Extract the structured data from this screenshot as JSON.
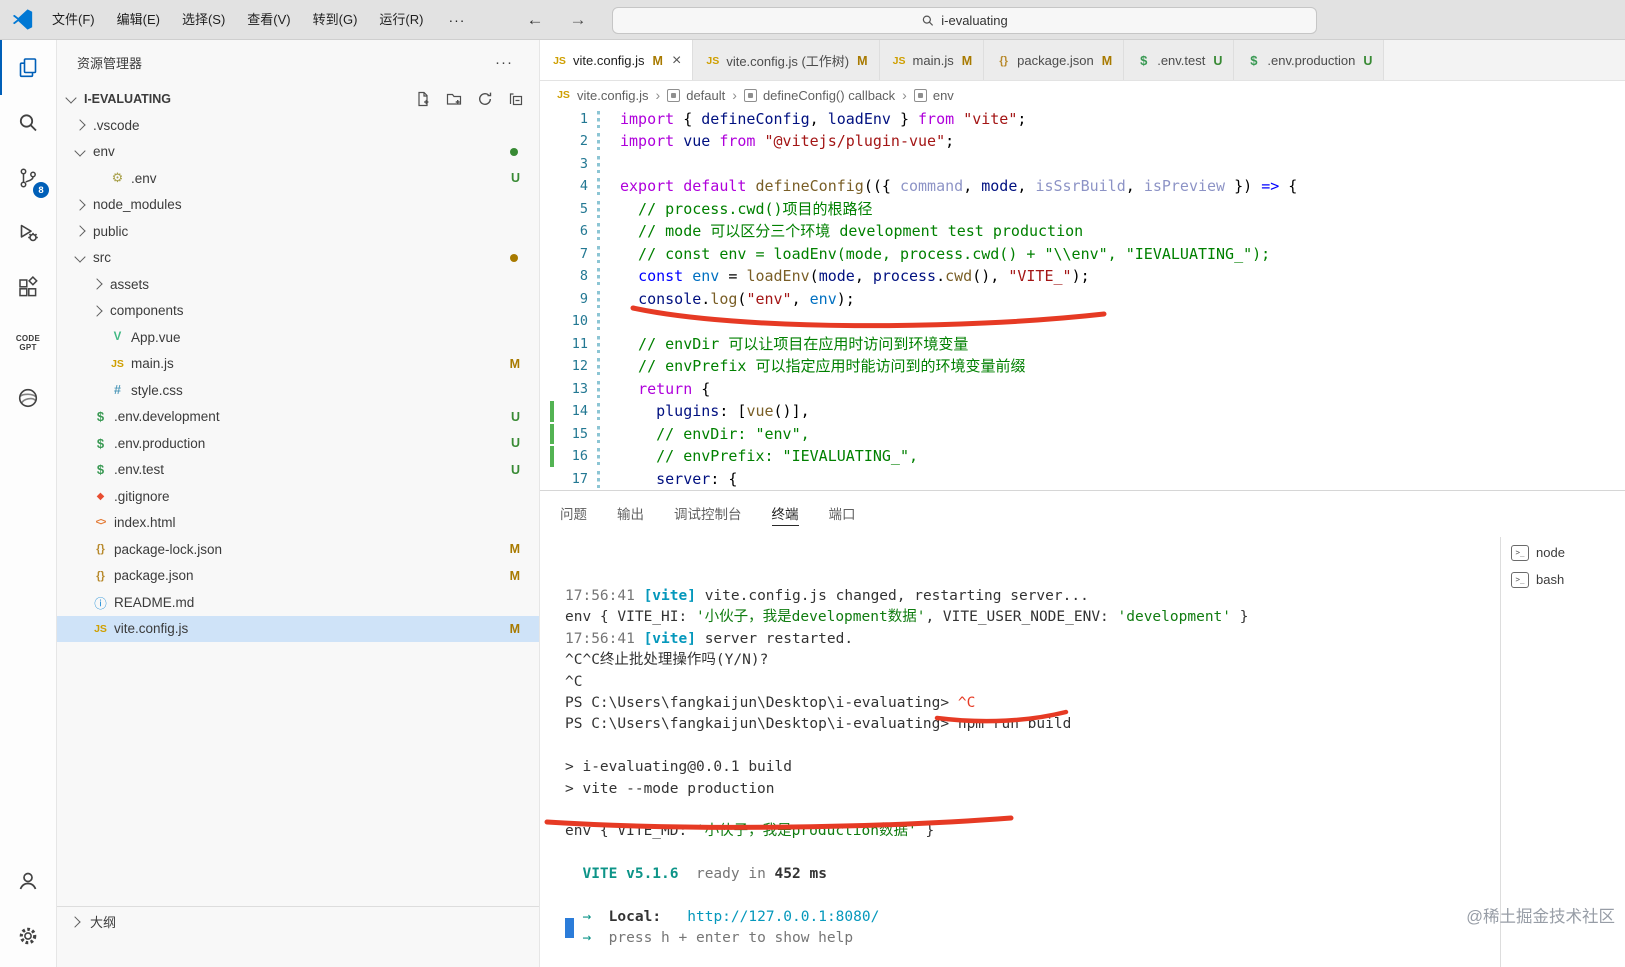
{
  "title_bar": {
    "menus": [
      "文件(F)",
      "编辑(E)",
      "选择(S)",
      "查看(V)",
      "转到(G)",
      "运行(R)"
    ],
    "more": "···",
    "nav_back": "←",
    "nav_forward": "→",
    "search_value": "i-evaluating"
  },
  "activity_bar": {
    "top": [
      {
        "name": "explorer",
        "active": true
      },
      {
        "name": "search"
      },
      {
        "name": "source-control",
        "badge": "8"
      },
      {
        "name": "run-debug"
      },
      {
        "name": "extensions"
      },
      {
        "name": "codegpt"
      },
      {
        "name": "browser"
      }
    ],
    "bottom": [
      {
        "name": "account"
      },
      {
        "name": "settings"
      }
    ],
    "codegpt_label": "CODE GPT"
  },
  "sidebar": {
    "title": "资源管理器",
    "more": "···",
    "root": "I-EVALUATING",
    "outline": "大纲",
    "items": [
      {
        "label": ".vscode",
        "indent": 1,
        "chevron": "right"
      },
      {
        "label": "env",
        "indent": 1,
        "chevron": "down",
        "dot": "unt"
      },
      {
        "label": ".env",
        "indent": 2,
        "icon": "gear",
        "badge": "U"
      },
      {
        "label": "node_modules",
        "indent": 1,
        "chevron": "right"
      },
      {
        "label": "public",
        "indent": 1,
        "chevron": "right"
      },
      {
        "label": "src",
        "indent": 1,
        "chevron": "down",
        "dot": "mod"
      },
      {
        "label": "assets",
        "indent": 2,
        "chevron": "right"
      },
      {
        "label": "components",
        "indent": 2,
        "chevron": "right"
      },
      {
        "label": "App.vue",
        "indent": 2,
        "icon": "vue"
      },
      {
        "label": "main.js",
        "indent": 2,
        "icon": "js",
        "badge": "M"
      },
      {
        "label": "style.css",
        "indent": 2,
        "icon": "css"
      },
      {
        "label": ".env.development",
        "indent": 1,
        "icon": "env",
        "badge": "U"
      },
      {
        "label": ".env.production",
        "indent": 1,
        "icon": "env",
        "badge": "U"
      },
      {
        "label": ".env.test",
        "indent": 1,
        "icon": "env",
        "badge": "U"
      },
      {
        "label": ".gitignore",
        "indent": 1,
        "icon": "git"
      },
      {
        "label": "index.html",
        "indent": 1,
        "icon": "html"
      },
      {
        "label": "package-lock.json",
        "indent": 1,
        "icon": "json",
        "badge": "M"
      },
      {
        "label": "package.json",
        "indent": 1,
        "icon": "json",
        "badge": "M"
      },
      {
        "label": "README.md",
        "indent": 1,
        "icon": "info"
      },
      {
        "label": "vite.config.js",
        "indent": 1,
        "icon": "js",
        "badge": "M",
        "selected": true
      }
    ]
  },
  "tabs": [
    {
      "icon": "js",
      "label": "vite.config.js",
      "badge": "M",
      "active": true
    },
    {
      "icon": "js",
      "label": "vite.config.js (工作树)",
      "badge": "M"
    },
    {
      "icon": "js",
      "label": "main.js",
      "badge": "M"
    },
    {
      "icon": "json",
      "label": "package.json",
      "badge": "M"
    },
    {
      "icon": "env",
      "label": ".env.test",
      "badge": "U"
    },
    {
      "icon": "env",
      "label": ".env.production",
      "badge": "U"
    }
  ],
  "breadcrumb": [
    {
      "icon": "js",
      "label": "vite.config.js"
    },
    {
      "icon": "sym",
      "label": "default"
    },
    {
      "icon": "sym",
      "label": "defineConfig() callback"
    },
    {
      "icon": "sym",
      "label": "env"
    }
  ],
  "editor": {
    "added_lines": [
      14,
      15,
      16
    ],
    "lines": [
      [
        [
          "k",
          "import"
        ],
        [
          "p",
          " { "
        ],
        [
          "v",
          "defineConfig"
        ],
        [
          "p",
          ", "
        ],
        [
          "v",
          "loadEnv"
        ],
        [
          "p",
          " } "
        ],
        [
          "k",
          "from"
        ],
        [
          "p",
          " "
        ],
        [
          "str",
          "\"vite\""
        ],
        [
          "p",
          ";"
        ]
      ],
      [
        [
          "k",
          "import"
        ],
        [
          "p",
          " "
        ],
        [
          "v",
          "vue"
        ],
        [
          "p",
          " "
        ],
        [
          "k",
          "from"
        ],
        [
          "p",
          " "
        ],
        [
          "str",
          "\"@vitejs/plugin-vue\""
        ],
        [
          "p",
          ";"
        ]
      ],
      [],
      [
        [
          "k",
          "export"
        ],
        [
          "p",
          " "
        ],
        [
          "k",
          "default"
        ],
        [
          "p",
          " "
        ],
        [
          "f",
          "defineConfig"
        ],
        [
          "p",
          "(({ "
        ],
        [
          "vd",
          "command"
        ],
        [
          "p",
          ", "
        ],
        [
          "v",
          "mode"
        ],
        [
          "p",
          ", "
        ],
        [
          "vd",
          "isSsrBuild"
        ],
        [
          "p",
          ", "
        ],
        [
          "vd",
          "isPreview"
        ],
        [
          "p",
          " }) "
        ],
        [
          "s",
          "=>"
        ],
        [
          "p",
          " {"
        ]
      ],
      [
        [
          "c",
          "  // process.cwd()项目的根路径"
        ]
      ],
      [
        [
          "c",
          "  // mode 可以区分三个环境 development test production"
        ]
      ],
      [
        [
          "c",
          "  // const env = loadEnv(mode, process.cwd() + \"\\\\env\", \"IEVALUATING_\");"
        ]
      ],
      [
        [
          "p",
          "  "
        ],
        [
          "s",
          "const"
        ],
        [
          "p",
          " "
        ],
        [
          "cv",
          "env"
        ],
        [
          "p",
          " = "
        ],
        [
          "f",
          "loadEnv"
        ],
        [
          "p",
          "("
        ],
        [
          "v",
          "mode"
        ],
        [
          "p",
          ", "
        ],
        [
          "v",
          "process"
        ],
        [
          "p",
          "."
        ],
        [
          "f",
          "cwd"
        ],
        [
          "p",
          "(), "
        ],
        [
          "str",
          "\"VITE_\""
        ],
        [
          "p",
          ");"
        ]
      ],
      [
        [
          "p",
          "  "
        ],
        [
          "v",
          "console"
        ],
        [
          "p",
          "."
        ],
        [
          "f",
          "log"
        ],
        [
          "p",
          "("
        ],
        [
          "str",
          "\"env\""
        ],
        [
          "p",
          ", "
        ],
        [
          "cv",
          "env"
        ],
        [
          "p",
          ");"
        ]
      ],
      [],
      [
        [
          "c",
          "  // envDir 可以让项目在应用时访问到环境变量"
        ]
      ],
      [
        [
          "c",
          "  // envPrefix 可以指定应用时能访问到的环境变量前缀"
        ]
      ],
      [
        [
          "p",
          "  "
        ],
        [
          "k",
          "return"
        ],
        [
          "p",
          " {"
        ]
      ],
      [
        [
          "p",
          "    "
        ],
        [
          "v",
          "plugins"
        ],
        [
          "p",
          ": ["
        ],
        [
          "f",
          "vue"
        ],
        [
          "p",
          "()],"
        ]
      ],
      [
        [
          "c",
          "    // envDir: \"env\","
        ]
      ],
      [
        [
          "c",
          "    // envPrefix: \"IEVALUATING_\","
        ]
      ],
      [
        [
          "p",
          "    "
        ],
        [
          "v",
          "server"
        ],
        [
          "p",
          ": {"
        ]
      ]
    ]
  },
  "panel": {
    "tabs": [
      {
        "label": "问题"
      },
      {
        "label": "输出"
      },
      {
        "label": "调试控制台"
      },
      {
        "label": "终端",
        "active": true
      },
      {
        "label": "端口"
      }
    ],
    "terminals": [
      {
        "label": "node"
      },
      {
        "label": "bash"
      }
    ],
    "terminal_lines": [
      [
        [
          "g",
          "17:56:41 "
        ],
        [
          "cy b",
          "[vite]"
        ],
        [
          "d",
          " vite.config.js changed, restarting server..."
        ]
      ],
      [
        [
          "d",
          "env { VITE_HI: "
        ],
        [
          "gr",
          "'小伙子，我是development数据'"
        ],
        [
          "d",
          ", VITE_USER_NODE_ENV: "
        ],
        [
          "gr",
          "'development'"
        ],
        [
          "d",
          " }"
        ]
      ],
      [
        [
          "g",
          "17:56:41 "
        ],
        [
          "cy b",
          "[vite]"
        ],
        [
          "d",
          " server restarted."
        ]
      ],
      [
        [
          "d",
          "^C^C终止批处理操作吗(Y/N)?"
        ]
      ],
      [
        [
          "d",
          "^C"
        ]
      ],
      [
        [
          "d",
          "PS C:\\Users\\fangkaijun\\Desktop\\i-evaluating> "
        ],
        [
          "rd",
          "^C"
        ]
      ],
      [
        [
          "d",
          "PS C:\\Users\\fangkaijun\\Desktop\\i-evaluating> "
        ],
        [
          "d",
          "npm run build"
        ]
      ],
      [],
      [
        [
          "d",
          "> i-evaluating@0.0.1 build"
        ]
      ],
      [
        [
          "d",
          "> vite --mode production"
        ]
      ],
      [],
      [
        [
          "d",
          "env { VITE_MD: "
        ],
        [
          "gr",
          "'小伙子，我是production数据'"
        ],
        [
          "d",
          " }"
        ]
      ],
      [],
      [
        [
          "d",
          "  "
        ],
        [
          "vg b",
          "VITE v5.1.6"
        ],
        [
          "d",
          "  "
        ],
        [
          "g",
          "ready in "
        ],
        [
          "d b",
          "452 ms"
        ]
      ],
      [],
      [
        [
          "d",
          "  "
        ],
        [
          "vg",
          "→"
        ],
        [
          "d",
          "  "
        ],
        [
          "d b",
          "Local:"
        ],
        [
          "d",
          "   "
        ],
        [
          "cy",
          "http://127.0.0.1:8080/"
        ]
      ],
      [
        [
          "d",
          "  "
        ],
        [
          "vg",
          "→"
        ],
        [
          "g",
          "  press h + enter to show help"
        ]
      ]
    ]
  },
  "annotations": {
    "color": "#e63a24",
    "items": [
      "console-log-underline",
      "ctrl-c-mark",
      "npm-run-build-underline",
      "env-output-underline"
    ]
  },
  "watermark": "@稀土掘金技术社区"
}
